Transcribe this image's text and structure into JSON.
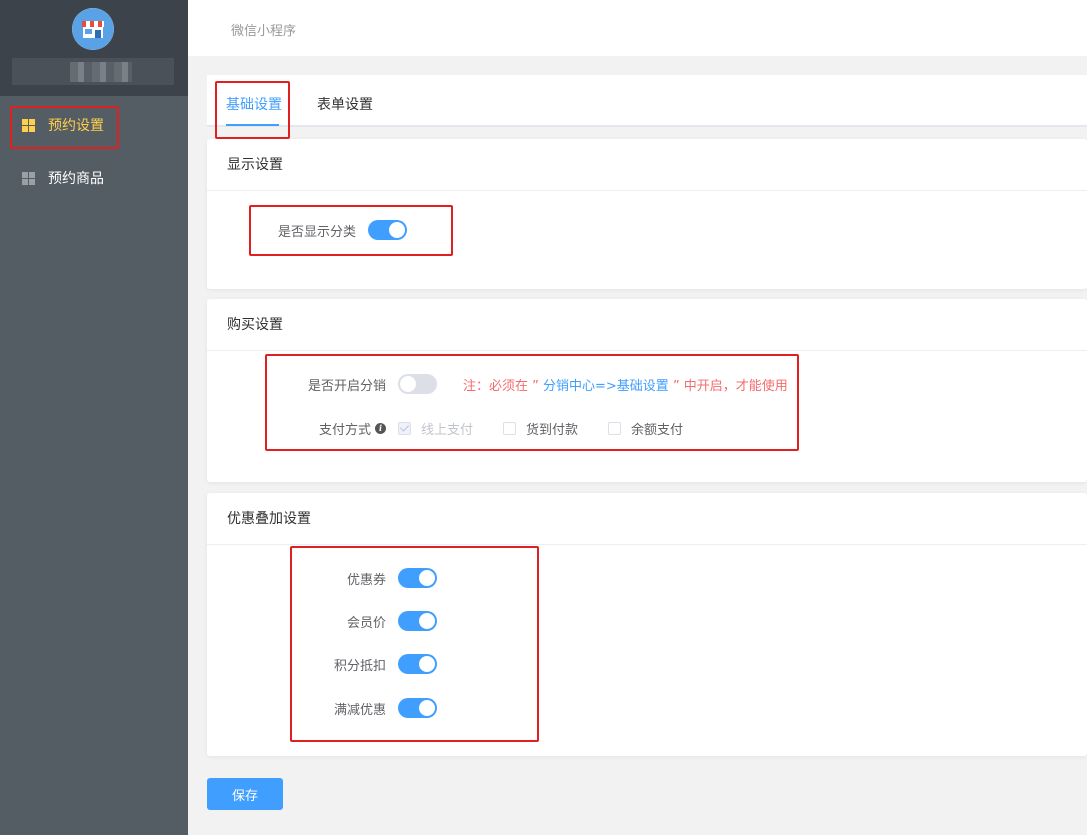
{
  "sidebar": {
    "shop_name": "",
    "items": [
      {
        "label": "预约设置",
        "active": true
      },
      {
        "label": "预约商品",
        "active": false
      }
    ]
  },
  "header": {
    "breadcrumb": "微信小程序"
  },
  "tabs": [
    {
      "label": "基础设置",
      "active": true
    },
    {
      "label": "表单设置",
      "active": false
    }
  ],
  "display_settings": {
    "title": "显示设置",
    "show_category": {
      "label": "是否显示分类",
      "on": true
    }
  },
  "purchase_settings": {
    "title": "购买设置",
    "enable_distribution": {
      "label": "是否开启分销",
      "on": false
    },
    "note_prefix": "注：必须在 ”",
    "note_link": " 分销中心=>基础设置 ",
    "note_suffix": "” 中开启，才能使用",
    "payment": {
      "label": "支付方式",
      "options": [
        {
          "label": "线上支付",
          "checked": true,
          "disabled": true
        },
        {
          "label": "货到付款",
          "checked": false,
          "disabled": false
        },
        {
          "label": "余额支付",
          "checked": false,
          "disabled": false
        }
      ]
    }
  },
  "discount_settings": {
    "title": "优惠叠加设置",
    "items": [
      {
        "label": "优惠券",
        "on": true
      },
      {
        "label": "会员价",
        "on": true
      },
      {
        "label": "积分抵扣",
        "on": true
      },
      {
        "label": "满减优惠",
        "on": true
      }
    ]
  },
  "save_label": "保存",
  "colors": {
    "primary": "#409eff",
    "sidebar": "#545c64",
    "active_menu": "#ffd04b",
    "annotation": "#e02020"
  }
}
